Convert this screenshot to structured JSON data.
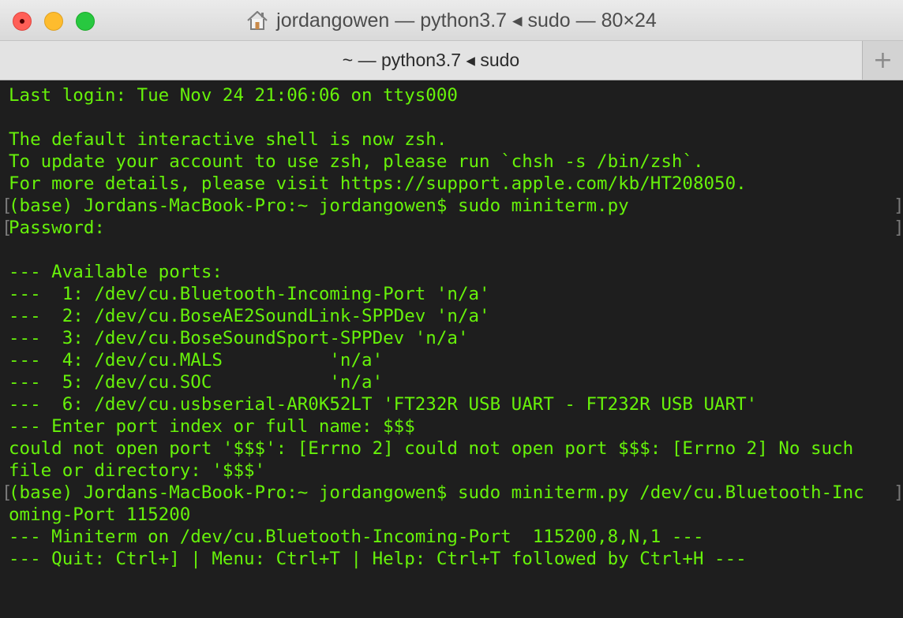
{
  "window": {
    "title": "jordangowen — python3.7 ◂ sudo — 80×24",
    "tab_label": "~ — python3.7 ◂ sudo",
    "new_tab_label": "+",
    "icons": {
      "title": "home-icon",
      "close": "close-button-icon",
      "minimize": "minimize-button-icon",
      "maximize": "zoom-button-icon"
    },
    "colors": {
      "terminal_bg": "#1e1e1e",
      "text": "#67f20a",
      "close": "#ff5f57",
      "minimize": "#febc2e",
      "maximize": "#28c840"
    }
  },
  "terminal": {
    "lines": [
      {
        "text": "Last login: Tue Nov 24 21:06:06 on ttys000",
        "marked": false
      },
      {
        "text": "",
        "marked": false
      },
      {
        "text": "The default interactive shell is now zsh.",
        "marked": false
      },
      {
        "text": "To update your account to use zsh, please run `chsh -s /bin/zsh`.",
        "marked": false
      },
      {
        "text": "For more details, please visit https://support.apple.com/kb/HT208050.",
        "marked": false
      },
      {
        "text": "(base) Jordans-MacBook-Pro:~ jordangowen$ sudo miniterm.py",
        "marked": true
      },
      {
        "text": "Password:",
        "marked": true
      },
      {
        "text": "",
        "marked": false
      },
      {
        "text": "--- Available ports:",
        "marked": false
      },
      {
        "text": "---  1: /dev/cu.Bluetooth-Incoming-Port 'n/a'",
        "marked": false
      },
      {
        "text": "---  2: /dev/cu.BoseAE2SoundLink-SPPDev 'n/a'",
        "marked": false
      },
      {
        "text": "---  3: /dev/cu.BoseSoundSport-SPPDev 'n/a'",
        "marked": false
      },
      {
        "text": "---  4: /dev/cu.MALS          'n/a'",
        "marked": false
      },
      {
        "text": "---  5: /dev/cu.SOC           'n/a'",
        "marked": false
      },
      {
        "text": "---  6: /dev/cu.usbserial-AR0K52LT 'FT232R USB UART - FT232R USB UART'",
        "marked": false
      },
      {
        "text": "--- Enter port index or full name: $$$",
        "marked": false
      },
      {
        "text": "could not open port '$$$': [Errno 2] could not open port $$$: [Errno 2] No such",
        "marked": false
      },
      {
        "text": "file or directory: '$$$'",
        "marked": false
      },
      {
        "text": "(base) Jordans-MacBook-Pro:~ jordangowen$ sudo miniterm.py /dev/cu.Bluetooth-Inc",
        "marked": true
      },
      {
        "text": "oming-Port 115200",
        "marked": false
      },
      {
        "text": "--- Miniterm on /dev/cu.Bluetooth-Incoming-Port  115200,8,N,1 ---",
        "marked": false
      },
      {
        "text": "--- Quit: Ctrl+] | Menu: Ctrl+T | Help: Ctrl+T followed by Ctrl+H ---",
        "marked": false
      }
    ]
  }
}
